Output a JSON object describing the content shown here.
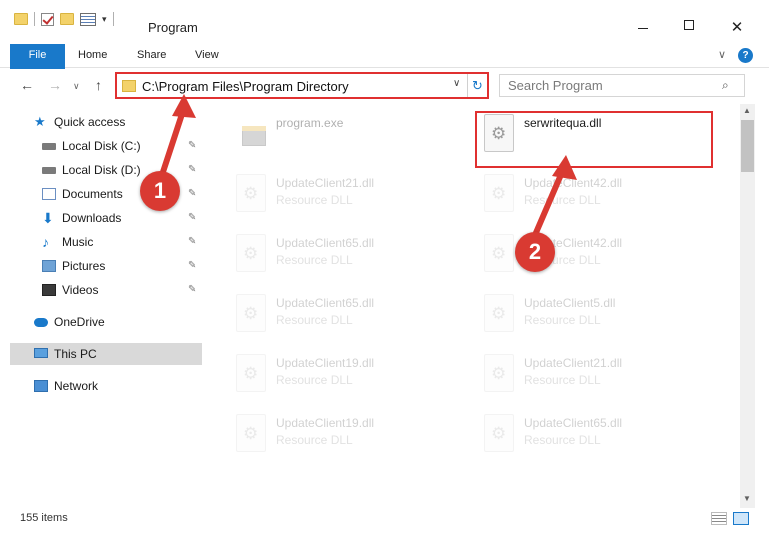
{
  "window": {
    "title": "Program",
    "minimize_icon": "minimize-icon",
    "maximize_icon": "maximize-icon",
    "close_glyph": "✕"
  },
  "ribbon": {
    "tabs": [
      "File",
      "Home",
      "Share",
      "View"
    ],
    "chevron": "∨",
    "help": "?"
  },
  "nav": {
    "back": "←",
    "forward": "→",
    "history": "∨",
    "up": "↑",
    "address": "C:\\Program Files\\Program Directory",
    "address_dropdown": "∨",
    "refresh": "↻",
    "search_placeholder": "Search Program",
    "search_icon": "⌕"
  },
  "sidebar": {
    "quick_access": "Quick access",
    "pinned": [
      {
        "label": "Local Disk (C:)",
        "icon": "drive-icon"
      },
      {
        "label": "Local Disk (D:)",
        "icon": "drive-icon"
      },
      {
        "label": "Documents",
        "icon": "documents-icon"
      },
      {
        "label": "Downloads",
        "icon": "downloads-icon"
      },
      {
        "label": "Music",
        "icon": "music-icon"
      },
      {
        "label": "Pictures",
        "icon": "pictures-icon"
      },
      {
        "label": "Videos",
        "icon": "videos-icon"
      }
    ],
    "onedrive": "OneDrive",
    "this_pc": "This PC",
    "network": "Network",
    "pin_glyph": "📌"
  },
  "files": [
    {
      "name": "program.exe",
      "type": ""
    },
    {
      "name": "serwritequa.dll",
      "type": ""
    },
    {
      "name": "UpdateClient21.dll",
      "type": "Resource DLL"
    },
    {
      "name": "UpdateClient42.dll",
      "type": "Resource DLL"
    },
    {
      "name": "UpdateClient65.dll",
      "type": "Resource DLL"
    },
    {
      "name": "UpdateClient42.dll",
      "type": "Resource DLL"
    },
    {
      "name": "UpdateClient65.dll",
      "type": "Resource DLL"
    },
    {
      "name": "UpdateClient5.dll",
      "type": "Resource DLL"
    },
    {
      "name": "UpdateClient19.dll",
      "type": "Resource DLL"
    },
    {
      "name": "UpdateClient21.dll",
      "type": "Resource DLL"
    },
    {
      "name": "UpdateClient19.dll",
      "type": "Resource DLL"
    },
    {
      "name": "UpdateClient65.dll",
      "type": "Resource DLL"
    }
  ],
  "status": {
    "item_count": "155 items"
  },
  "callouts": [
    "1",
    "2"
  ],
  "colors": {
    "accent": "#1979ca",
    "highlight": "#e03030",
    "callout": "#d93a32"
  }
}
